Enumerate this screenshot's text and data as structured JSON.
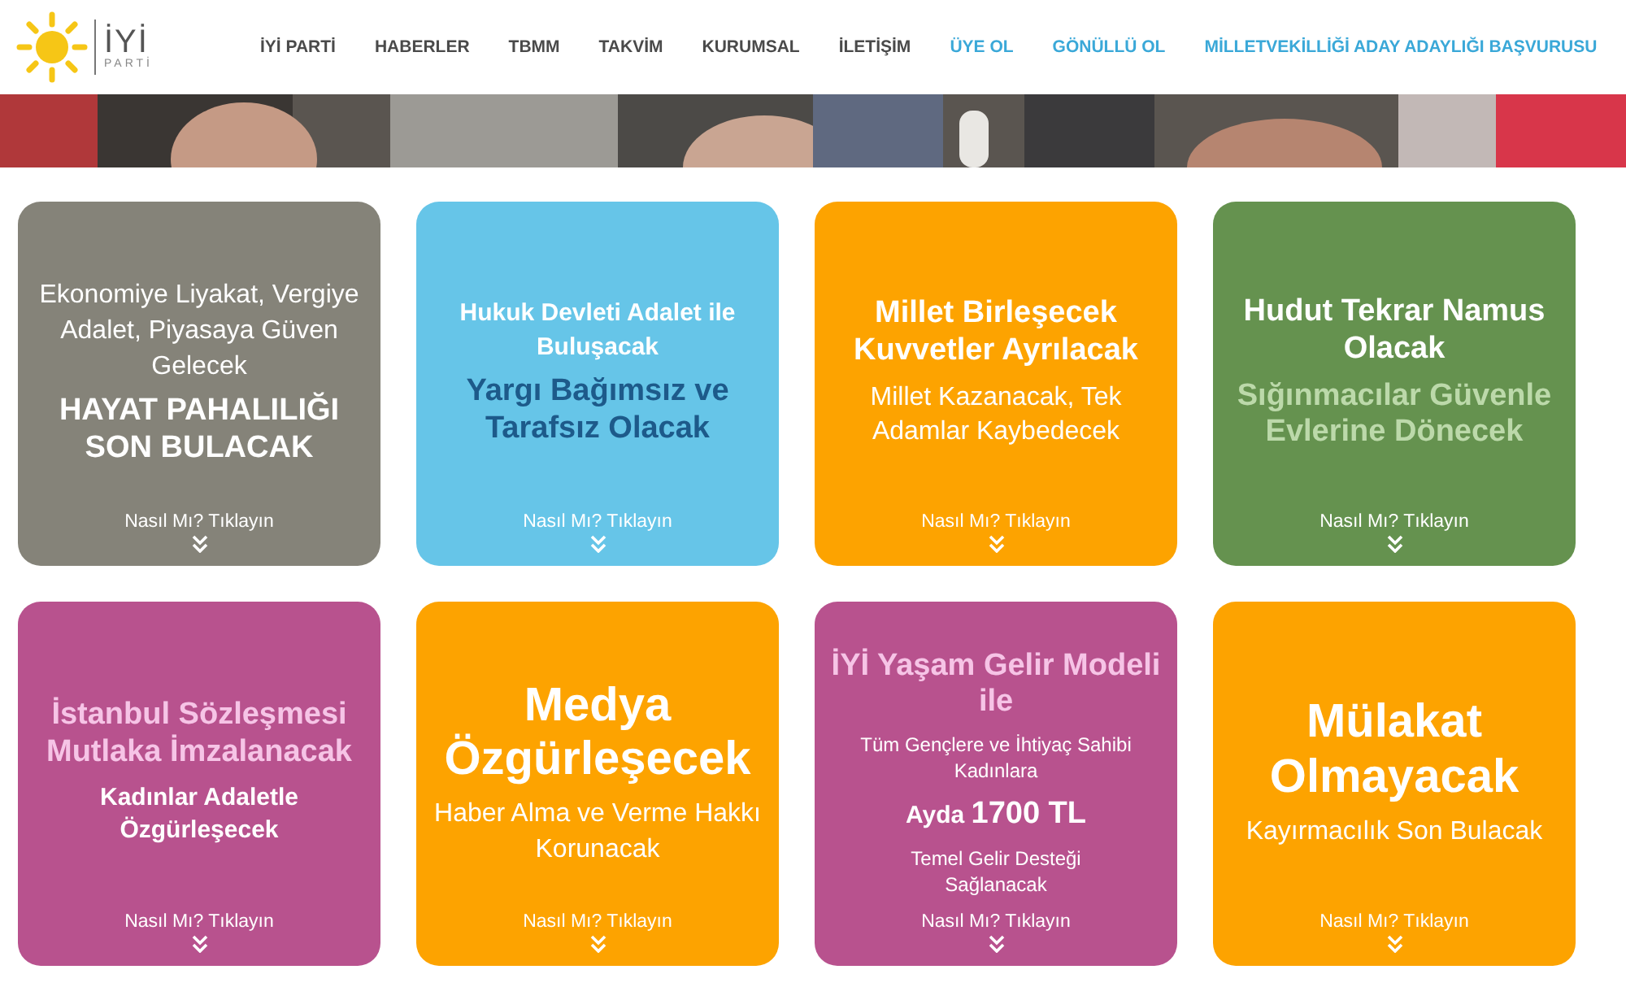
{
  "logo": {
    "name": "İYİ",
    "sub": "PARTİ"
  },
  "nav": [
    {
      "label": "İYİ PARTİ",
      "kind": "plain"
    },
    {
      "label": "HABERLER",
      "kind": "plain"
    },
    {
      "label": "TBMM",
      "kind": "plain"
    },
    {
      "label": "TAKVİM",
      "kind": "plain"
    },
    {
      "label": "KURUMSAL",
      "kind": "plain"
    },
    {
      "label": "İLETİŞİM",
      "kind": "plain"
    },
    {
      "label": "ÜYE OL",
      "kind": "highlight"
    },
    {
      "label": "GÖNÜLLÜ OL",
      "kind": "highlight"
    },
    {
      "label": "MİLLETVEKİLLİĞİ ADAY ADAYLIĞI BAŞVURUSU",
      "kind": "highlight"
    }
  ],
  "cards": [
    {
      "color": "#858379",
      "lines": [
        {
          "kind": "plain",
          "color": "#ffffff",
          "text": "Ekonomiye Liyakat, Vergiye Adalet, Piyasaya Güven Gelecek"
        },
        {
          "kind": "headline",
          "color": "#ffffff",
          "text": "HAYAT PAHALILIĞI SON BULACAK"
        }
      ],
      "link": "Nasıl Mı? Tıklayın"
    },
    {
      "color": "#66c5e8",
      "lines": [
        {
          "kind": "bold",
          "color": "#ffffff",
          "text": "Hukuk Devleti Adalet ile Buluşacak"
        },
        {
          "kind": "headline",
          "color": "#1d5a8a",
          "text": "Yargı Bağımsız ve Tarafsız Olacak"
        }
      ],
      "link": "Nasıl Mı? Tıklayın"
    },
    {
      "color": "#fda300",
      "lines": [
        {
          "kind": "headline",
          "color": "#ffffff",
          "text": "Millet Birleşecek Kuvvetler Ayrılacak"
        },
        {
          "kind": "plain",
          "color": "#ffffff",
          "text": "Millet Kazanacak, Tek Adamlar Kaybedecek"
        }
      ],
      "link": "Nasıl Mı? Tıklayın"
    },
    {
      "color": "#65924f",
      "lines": [
        {
          "kind": "headline",
          "color": "#ffffff",
          "text": "Hudut Tekrar Namus Olacak"
        },
        {
          "kind": "headline",
          "color": "#bcd9aa",
          "text": "Sığınmacılar Güvenle Evlerine Dönecek"
        }
      ],
      "link": "Nasıl Mı? Tıklayın"
    },
    {
      "color": "#b8528e",
      "lines": [
        {
          "kind": "headline",
          "color": "#f6c4e6",
          "text": "İstanbul Sözleşmesi Mutlaka İmzalanacak"
        },
        {
          "kind": "bold",
          "color": "#ffffff",
          "text": "Kadınlar Adaletle Özgürleşecek"
        }
      ],
      "link": "Nasıl Mı? Tıklayın"
    },
    {
      "color": "#fda300",
      "lines": [
        {
          "kind": "huge",
          "color": "#ffffff",
          "text": "Medya Özgürleşecek"
        },
        {
          "kind": "plain",
          "color": "#ffffff",
          "text": "Haber Alma ve Verme Hakkı Korunacak"
        }
      ],
      "link": "Nasıl Mı? Tıklayın"
    },
    {
      "color": "#b8528e",
      "lines": [
        {
          "kind": "headline",
          "color": "#f6c4e6",
          "text": "İYİ Yaşam Gelir Modeli ile"
        },
        {
          "kind": "small",
          "color": "#ffffff",
          "text": "Tüm Gençlere ve İhtiyaç Sahibi Kadınlara"
        },
        {
          "kind": "amount",
          "color": "#ffffff",
          "prefix": "Ayda",
          "text": "1700 TL"
        },
        {
          "kind": "small",
          "color": "#ffffff",
          "text": "Temel Gelir Desteği Sağlanacak"
        }
      ],
      "link": "Nasıl Mı? Tıklayın"
    },
    {
      "color": "#fda300",
      "lines": [
        {
          "kind": "huge",
          "color": "#ffffff",
          "text": "Mülakat Olmayacak"
        },
        {
          "kind": "plain",
          "color": "#ffffff",
          "text": "Kayırmacılık Son Bulacak"
        }
      ],
      "link": "Nasıl Mı? Tıklayın"
    }
  ]
}
